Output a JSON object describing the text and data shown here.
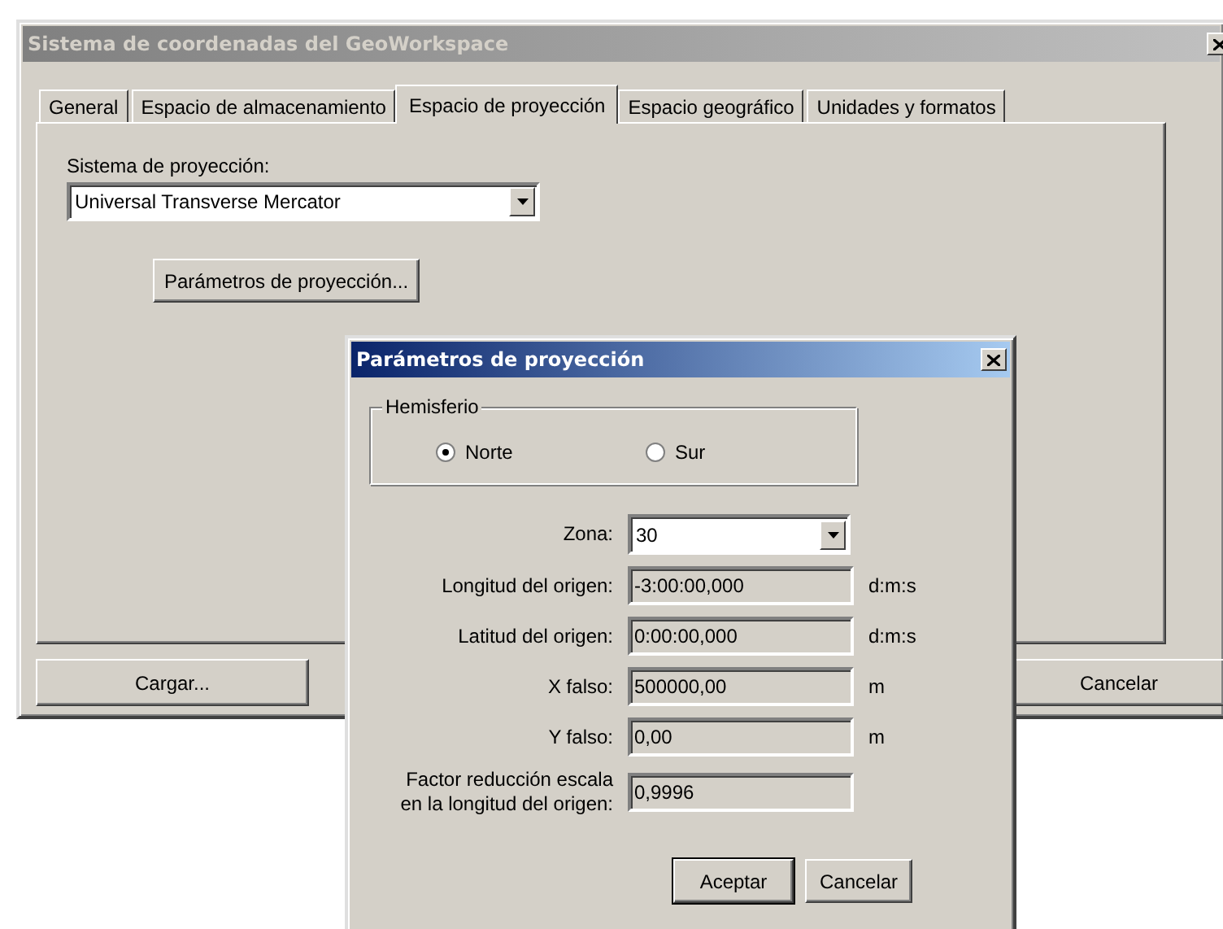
{
  "window": {
    "title": "Sistema de coordenadas del GeoWorkspace",
    "active": false
  },
  "tabs": [
    {
      "label": "General",
      "selected": false
    },
    {
      "label": "Espacio de almacenamiento",
      "selected": false
    },
    {
      "label": "Espacio de proyección",
      "selected": true
    },
    {
      "label": "Espacio geográfico",
      "selected": false
    },
    {
      "label": "Unidades y formatos",
      "selected": false
    }
  ],
  "projection_tab": {
    "system_label": "Sistema de proyección:",
    "system_value": "Universal Transverse Mercator",
    "params_button": "Parámetros de proyección..."
  },
  "buttons": [
    "Cargar...",
    "Cancelar"
  ],
  "dialog": {
    "title": "Parámetros de proyección",
    "active": true,
    "hemisphere": {
      "label": "Hemisferio",
      "options": [
        {
          "label": "Norte",
          "selected": true
        },
        {
          "label": "Sur",
          "selected": false
        }
      ]
    },
    "fields": [
      {
        "kind": "combo",
        "label": "Zona:",
        "value": "30"
      },
      {
        "kind": "readonly",
        "label": "Longitud del origen:",
        "value": "-3:00:00,000",
        "unit": "d:m:s"
      },
      {
        "kind": "readonly",
        "label": "Latitud del origen:",
        "value": "0:00:00,000",
        "unit": "d:m:s"
      },
      {
        "kind": "readonly",
        "label": "X falso:",
        "value": "500000,00",
        "unit": "m"
      },
      {
        "kind": "readonly",
        "label": "Y falso:",
        "value": "0,00",
        "unit": "m"
      },
      {
        "kind": "readonly",
        "label": "Factor reducción escala\nen la longitud del origen:",
        "value": "0,9996"
      }
    ],
    "buttons": [
      "Aceptar",
      "Cancelar"
    ]
  }
}
